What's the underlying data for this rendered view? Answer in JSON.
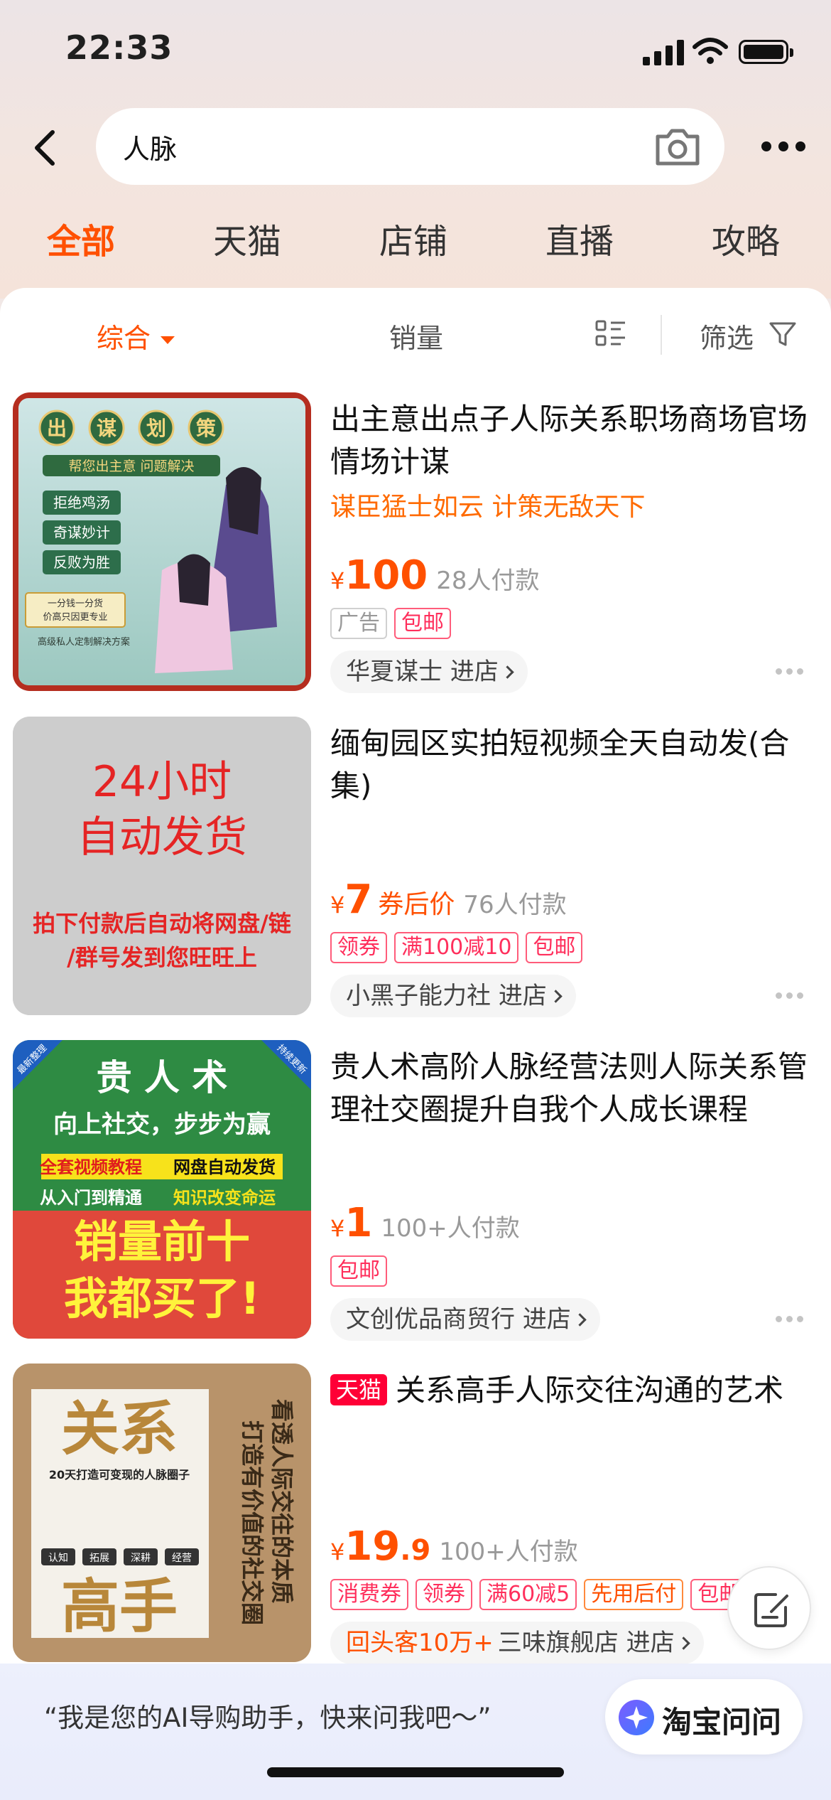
{
  "status_bar": {
    "time": "22:33"
  },
  "search": {
    "query": "人脉"
  },
  "tabs": [
    {
      "label": "全部",
      "active": true
    },
    {
      "label": "天猫",
      "active": false
    },
    {
      "label": "店铺",
      "active": false
    },
    {
      "label": "直播",
      "active": false
    },
    {
      "label": "攻略",
      "active": false
    }
  ],
  "sort_bar": {
    "comprehensive": "综合",
    "sales": "销量",
    "filter": "筛选"
  },
  "products": [
    {
      "title": "出主意出点子人际关系职场商场官场情场计谋",
      "slogan": "谋臣猛士如云 计策无敌天下",
      "currency": "¥",
      "price": "100",
      "sold": "28人付款",
      "tags": [
        "广告",
        "包邮"
      ],
      "shop": "华夏谋士",
      "enter": "进店",
      "image_text": {
        "title_chars": [
          "出",
          "谋",
          "划",
          "策"
        ],
        "ribbon": "帮您出主意 问题解决",
        "points": [
          "拒绝鸡汤",
          "奇谋妙计",
          "反败为胜"
        ],
        "card": "一分钱一分货\n价高只因更专业",
        "footer": "高级私人定制解决方案"
      }
    },
    {
      "title": "缅甸园区实拍短视频全天自动发(合集)",
      "currency": "¥",
      "price": "7",
      "price_label": "券后价",
      "sold": "76人付款",
      "tags": [
        "领券",
        "满100减10",
        "包邮"
      ],
      "shop": "小黑子能力社",
      "enter": "进店",
      "image_text": {
        "line1": "24小时",
        "line2": "自动发货",
        "line3": "拍下付款后自动将网盘/链",
        "line4": "/群号发到您旺旺上"
      }
    },
    {
      "title": "贵人术高阶人脉经营法则人际关系管理社交圈提升自我个人成长课程",
      "currency": "¥",
      "price": "1",
      "sold": "100+人付款",
      "tags": [
        "包邮"
      ],
      "shop": "文创优品商贸行",
      "enter": "进店",
      "image_text": {
        "corner_left": "最新整理",
        "corner_right": "持续更新",
        "title": "贵 人 术",
        "subtitle": "向上社交，步步为赢",
        "hl1": "全套视频教程",
        "hl2": "网盘自动发货",
        "hl3": "从入门到精通",
        "hl4": "知识改变命运",
        "big1": "销量前十",
        "big2": "我都买了!"
      }
    },
    {
      "badge": "天猫",
      "title": "关系高手人际交往沟通的艺术",
      "currency": "¥",
      "price": "19",
      "price_decimal": ".9",
      "sold": "100+人付款",
      "tags": [
        "消费券",
        "领券",
        "满60减5",
        "先用后付",
        "包邮"
      ],
      "shop_prefix": "回头客10万+",
      "shop": "三味旗舰店",
      "enter": "进店",
      "image_text": {
        "book_top": "关系",
        "book_bottom": "高手",
        "book_sub": "20天打造可变现的人脉圈子",
        "steps": [
          "认知",
          "拓展",
          "深耕",
          "经营"
        ],
        "right_col1": "看透人际交往的本质",
        "right_col2": "打造有价值的社交圈"
      }
    }
  ],
  "assistant": {
    "prompt": "“我是您的AI导购助手，快来问我吧～”",
    "button": "淘宝问问"
  },
  "colors": {
    "accent": "#ff5000",
    "tag_red": "#ff2f5c",
    "tmall_red": "#ff0036"
  },
  "icons": [
    "back-icon",
    "camera-icon",
    "more-icon",
    "caret-down-icon",
    "list-view-icon",
    "filter-icon",
    "chevron-right-icon",
    "edit-icon",
    "assistant-star-icon"
  ]
}
